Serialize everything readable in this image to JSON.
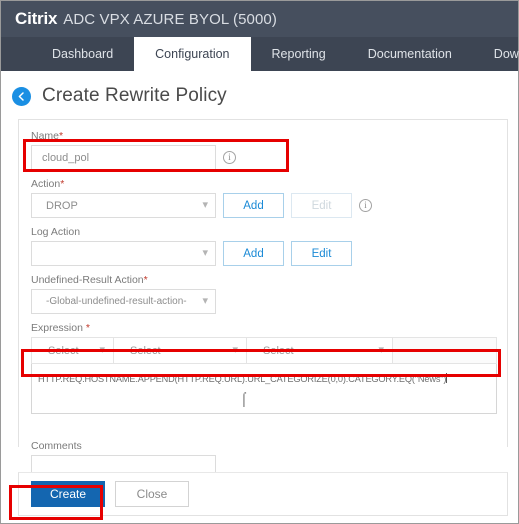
{
  "brand": {
    "logo": "Citrix",
    "product": "ADC VPX AZURE BYOL (5000)"
  },
  "nav": {
    "tabs": [
      {
        "label": "Dashboard",
        "active": false
      },
      {
        "label": "Configuration",
        "active": true
      },
      {
        "label": "Reporting",
        "active": false
      },
      {
        "label": "Documentation",
        "active": false
      },
      {
        "label": "Downloads",
        "active": false
      }
    ]
  },
  "page": {
    "back_icon": "back-arrow-icon",
    "title": "Create Rewrite Policy"
  },
  "form": {
    "name": {
      "label": "Name",
      "required": "*",
      "value": "cloud_pol",
      "info_icon": "info-icon"
    },
    "action": {
      "label": "Action",
      "required": "*",
      "value": "DROP",
      "add_label": "Add",
      "edit_label": "Edit",
      "edit_disabled": true,
      "info_icon": "info-icon"
    },
    "log_action": {
      "label": "Log Action",
      "required": "",
      "value": "",
      "add_label": "Add",
      "edit_label": "Edit",
      "edit_disabled": false
    },
    "undefined_result_action": {
      "label": "Undefined-Result Action",
      "required": "*",
      "value": "-Global-undefined-result-action-"
    },
    "expression": {
      "label": "Expression",
      "required": "*",
      "select_1": "Select",
      "select_2": "Select",
      "select_3": "Select",
      "value": "HTTP.REQ.HOSTNAME.APPEND(HTTP.REQ.URL).URL_CATEGORIZE(0,0).CATEGORY.EQ(\"News\")"
    },
    "comments": {
      "label": "Comments",
      "value": ""
    }
  },
  "footer": {
    "create_label": "Create",
    "close_label": "Close"
  },
  "colors": {
    "brand_bar": "#464f5e",
    "nav_bar": "#3d4553",
    "accent_blue": "#1466b0",
    "link_blue": "#1b8ad6",
    "annotation_red": "#e60000"
  }
}
